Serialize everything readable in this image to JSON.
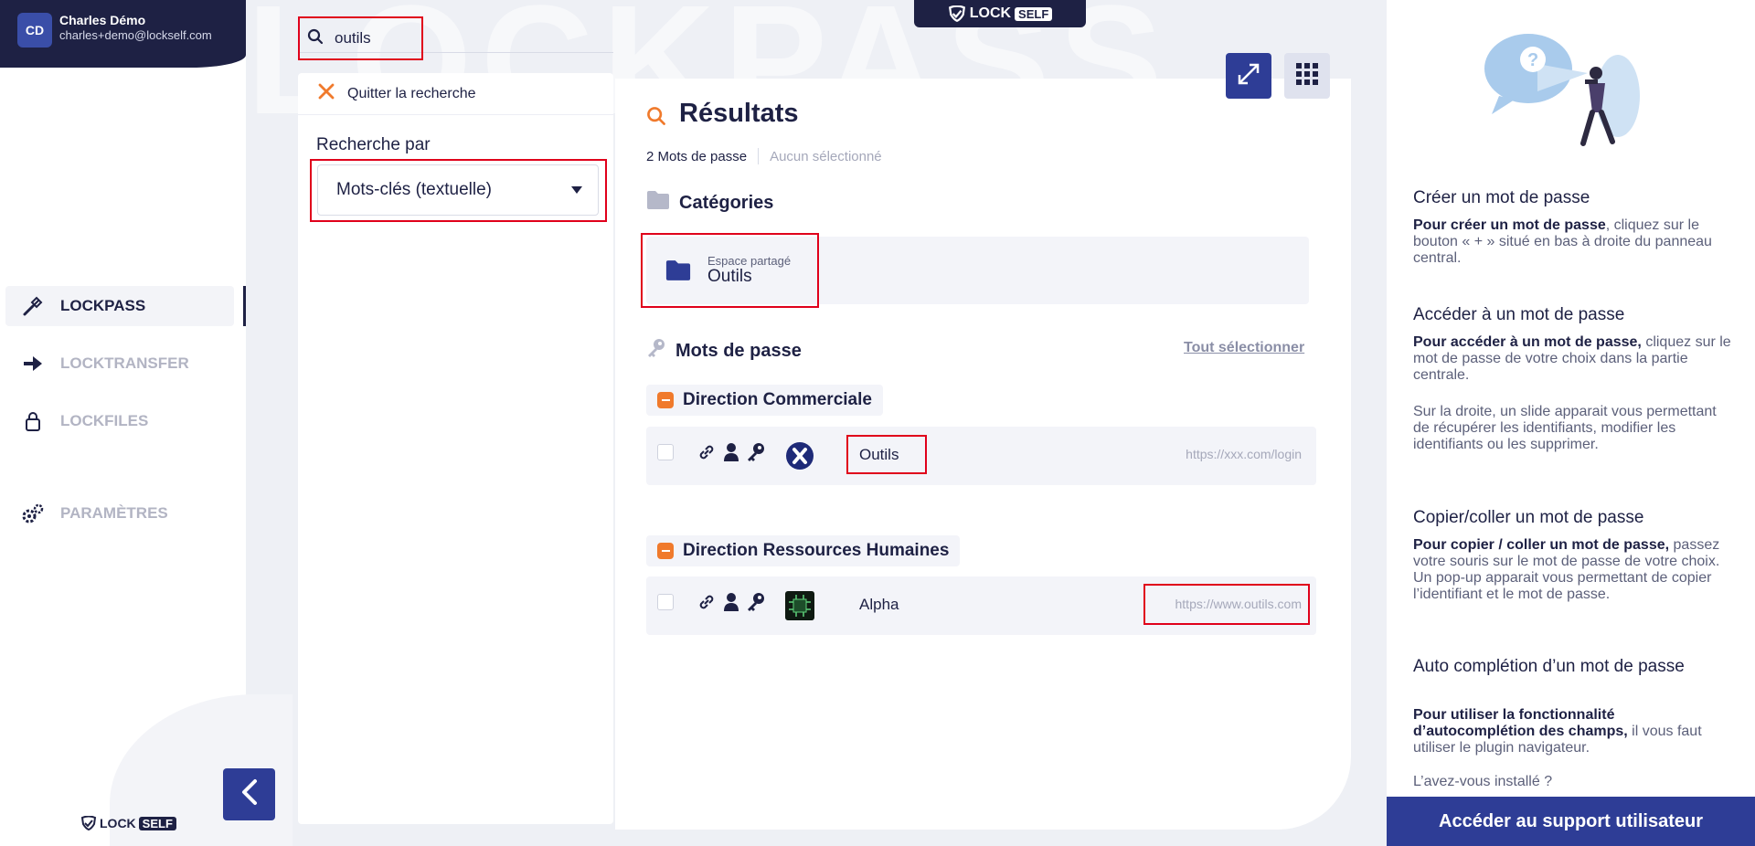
{
  "user": {
    "initials": "CD",
    "name": "Charles Démo",
    "email": "charles+demo@lockself.com"
  },
  "nav": {
    "items": [
      {
        "label": "LOCKPASS",
        "icon": "tools-icon",
        "active": true
      },
      {
        "label": "LOCKTRANSFER",
        "icon": "arrow-right-icon",
        "active": false
      },
      {
        "label": "LOCKFILES",
        "icon": "lock-icon",
        "active": false
      },
      {
        "label": "PARAMÈTRES",
        "icon": "gears-icon",
        "active": false
      }
    ]
  },
  "brand": {
    "lock": "LOCK",
    "self": "SELF"
  },
  "watermark": "LOCKPASS",
  "search": {
    "value": "outils",
    "quit_label": "Quitter la recherche",
    "search_by_label": "Recherche par",
    "mode_selected": "Mots-clés (textuelle)"
  },
  "results": {
    "title": "Résultats",
    "count": "2 Mots de passe",
    "selection": "Aucun sélectionné",
    "categories_title": "Catégories",
    "category": {
      "subtitle": "Espace partagé",
      "name": "Outils"
    },
    "passwords_title": "Mots de passe",
    "select_all": "Tout sélectionner",
    "groups": [
      {
        "name": "Direction Commerciale",
        "items": [
          {
            "name": "Outils",
            "url": "https://xxx.com/login"
          }
        ]
      },
      {
        "name": "Direction Ressources Humaines",
        "items": [
          {
            "name": "Alpha",
            "url": "https://www.outils.com"
          }
        ]
      }
    ]
  },
  "help": {
    "sections": [
      {
        "title": "Créer un mot de passe",
        "bold": "Pour créer un mot de passe",
        "text": ", cliquez sur le bouton « + » situé en bas à droite du panneau central."
      },
      {
        "title": "Accéder à un mot de passe",
        "bold": "Pour accéder à un mot de passe,",
        "text": " cliquez sur le mot de passe de votre choix dans la partie centrale.",
        "extra": "Sur la droite, un slide apparait vous permettant de récupérer les identifiants, modifier les identifiants ou les supprimer."
      },
      {
        "title": "Copier/coller un mot de passe",
        "bold": "Pour copier / coller un mot de passe,",
        "text": " passez votre souris sur le mot de passe de votre choix. Un pop-up apparait vous permettant de copier l’identifiant et le mot de passe."
      },
      {
        "title": "Auto complétion d’un mot de passe",
        "bold": "Pour utiliser la fonctionnalité d’autocomplétion des champs,",
        "text": " il vous faut utiliser le plugin navigateur.",
        "extra": "L’avez-vous installé ?"
      }
    ],
    "support_button": "Accéder au support utilisateur"
  },
  "colors": {
    "navy": "#1e2144",
    "accent_blue": "#2e3d96",
    "orange": "#f07a2c",
    "highlight_red": "#e0001b"
  }
}
